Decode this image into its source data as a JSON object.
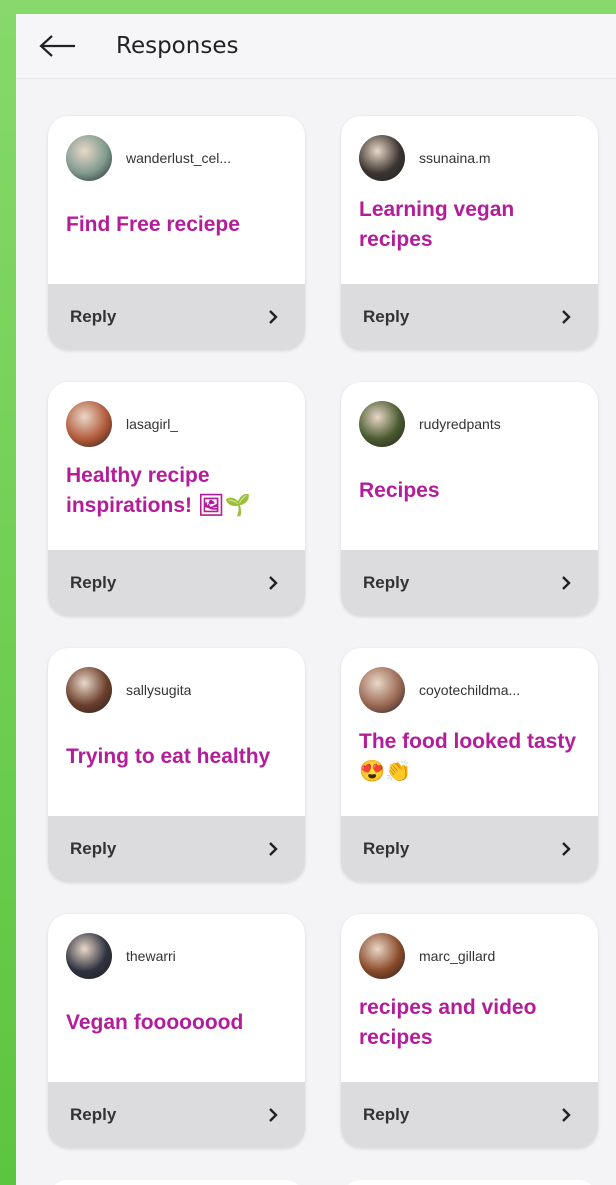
{
  "header": {
    "title": "Responses",
    "back_icon": "arrow-left-icon"
  },
  "cards": [
    {
      "username": "wanderlust_cel...",
      "text": "Find Free reciepe",
      "reply": "Reply",
      "avatar_color": "#7f9a8f"
    },
    {
      "username": "ssunaina.m",
      "text": "Learning vegan recipes",
      "reply": "Reply",
      "avatar_color": "#3c3530"
    },
    {
      "username": "lasagirl_",
      "text": "Healthy recipe inspirations! 🖼🌱",
      "reply": "Reply",
      "avatar_color": "#b25a3a"
    },
    {
      "username": "rudyredpants",
      "text": "Recipes",
      "reply": "Reply",
      "avatar_color": "#4a5a2f"
    },
    {
      "username": "sallysugita",
      "text": "Trying to eat healthy",
      "reply": "Reply",
      "avatar_color": "#6b3e2c"
    },
    {
      "username": "coyotechildma...",
      "text": "The food looked tasty 😍👏",
      "reply": "Reply",
      "avatar_color": "#9b6a55"
    },
    {
      "username": "thewarri",
      "text": "Vegan foooooood",
      "reply": "Reply",
      "avatar_color": "#2f3340"
    },
    {
      "username": "marc_gillard",
      "text": "recipes and video recipes",
      "reply": "Reply",
      "avatar_color": "#8a4a2a"
    }
  ],
  "colors": {
    "accent_text": "#b41d9a",
    "reply_bar": "#dcdcde",
    "background_green": "#6ccf4e"
  }
}
